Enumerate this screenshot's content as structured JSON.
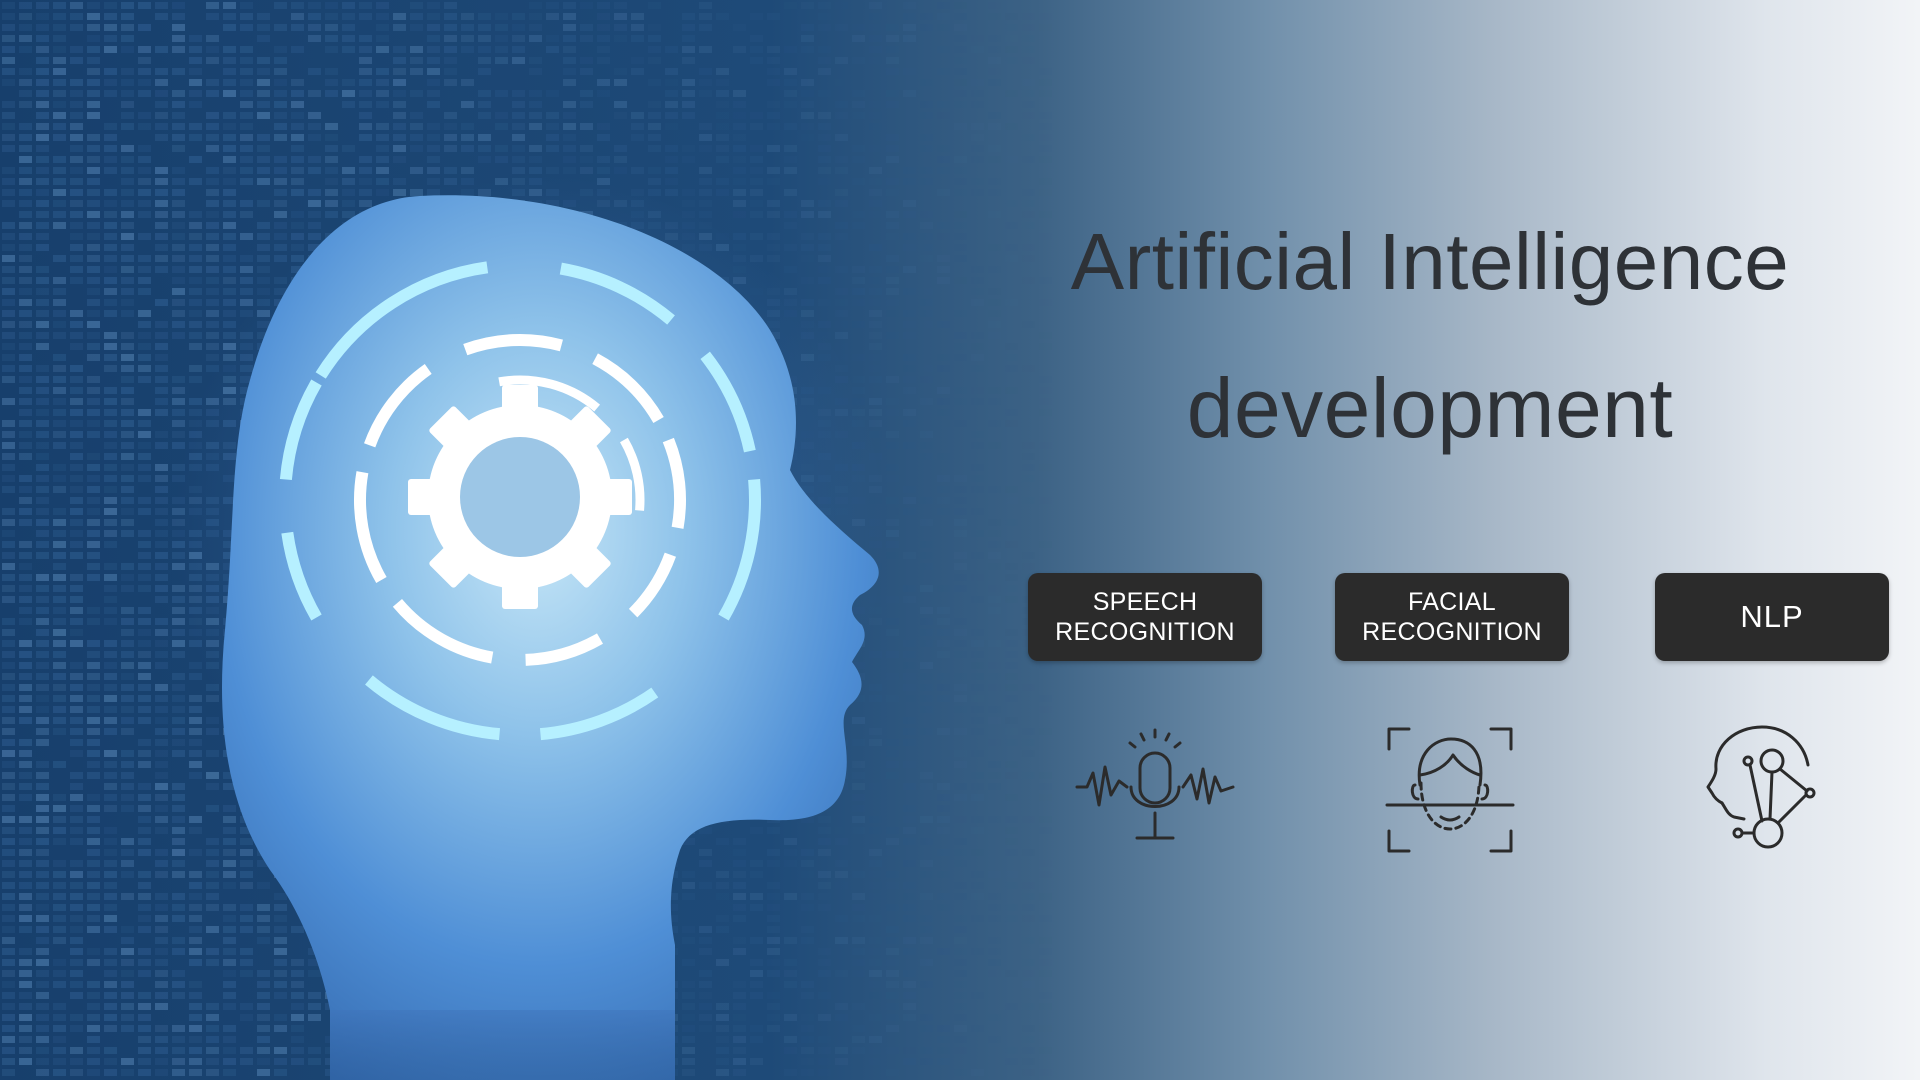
{
  "banner": {
    "title_line1": "Artificial Intelligence",
    "title_line2": "development"
  },
  "features": [
    {
      "label_lines": [
        "SPEECH",
        "RECOGNITION"
      ],
      "icon": "microphone-waveform-icon"
    },
    {
      "label_lines": [
        "FACIAL",
        "RECOGNITION"
      ],
      "icon": "face-scan-icon"
    },
    {
      "label_lines": [
        "NLP"
      ],
      "icon": "head-network-icon"
    }
  ],
  "illustration": {
    "subject": "head-silhouette",
    "icon": "gear-icon"
  },
  "colors": {
    "background_dark": "#173f6c",
    "background_light": "#f2f4f7",
    "head_glow": "#a8e8ff",
    "badge": "#2b2b2b",
    "title_text": "#2e3237"
  }
}
